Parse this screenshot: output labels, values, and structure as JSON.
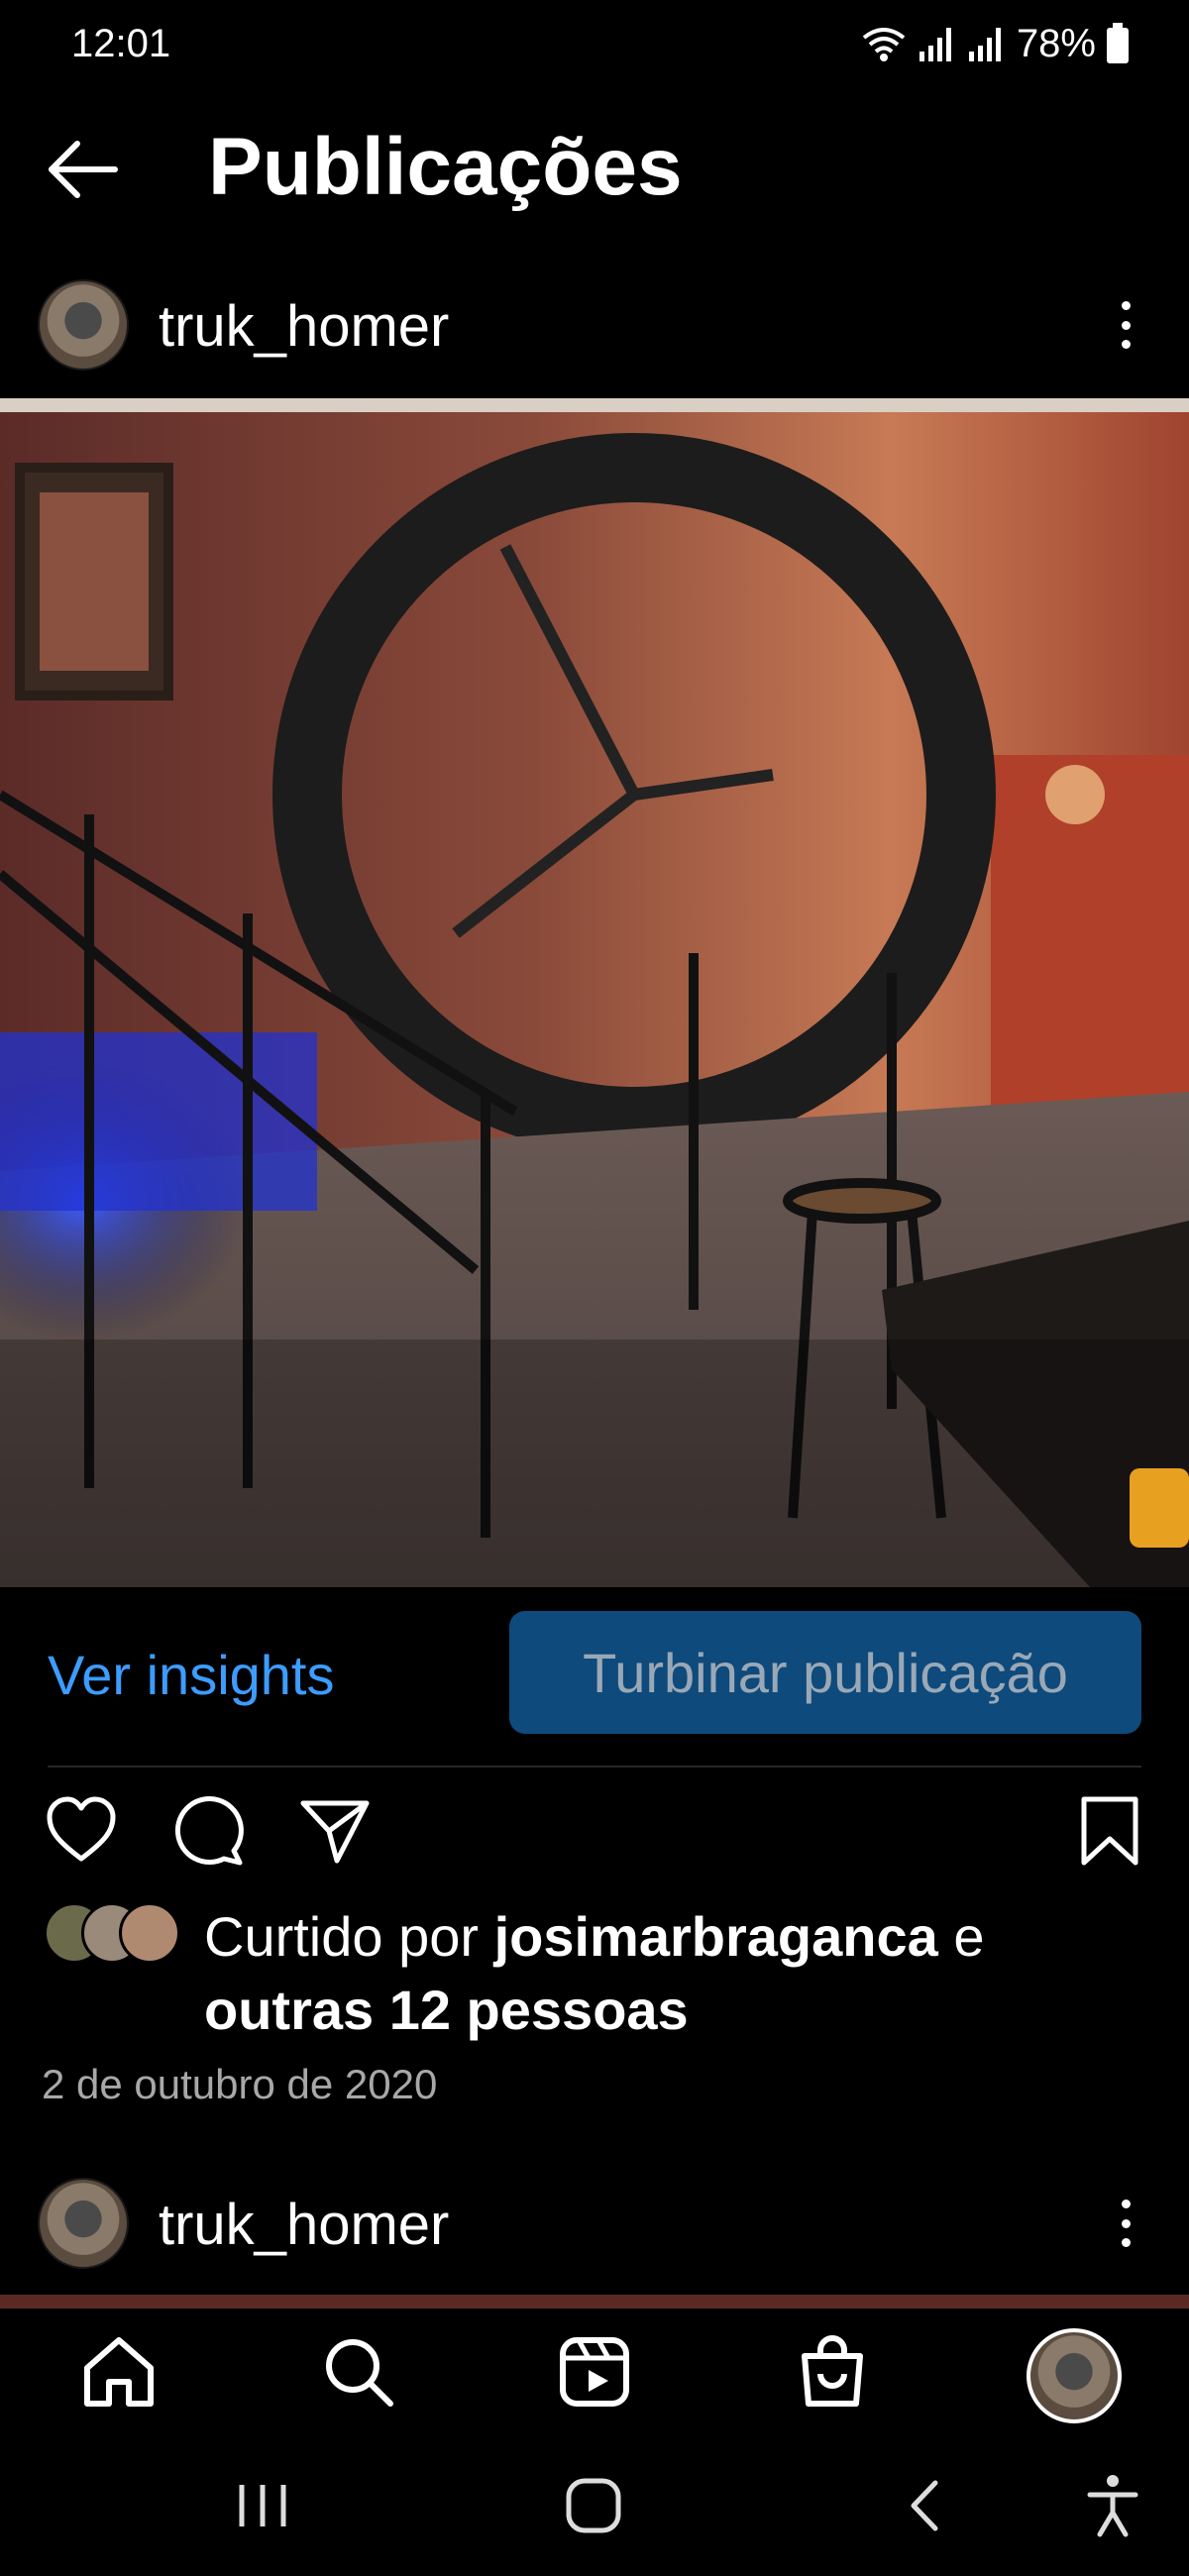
{
  "status_bar": {
    "time": "12:01",
    "battery": "78%",
    "icons": [
      "wifi-icon",
      "signal-icon",
      "signal-icon",
      "battery-icon"
    ]
  },
  "header": {
    "title": "Publicações",
    "back_icon": "arrow-left-icon"
  },
  "post": {
    "username": "truk_homer",
    "more_icon": "more-vertical-icon",
    "photo_alt": "photo"
  },
  "insights": {
    "view_label": "Ver insights",
    "boost_label": "Turbinar publicação"
  },
  "actions": {
    "icons": [
      "heart-icon",
      "comment-icon",
      "share-icon",
      "bookmark-icon"
    ]
  },
  "likes": {
    "prefix": "Curtido por ",
    "user": "josimarbraganca",
    "conjunction": " e",
    "others": "outras 12 pessoas"
  },
  "date": "2 de outubro de 2020",
  "next_post": {
    "username": "truk_homer"
  },
  "nav": {
    "icons": [
      "home-icon",
      "search-icon",
      "reels-icon",
      "shop-icon",
      "profile-avatar"
    ]
  },
  "colors": {
    "background": "#000000",
    "accent": "#3d9cff",
    "boost_bg": "#0e4a7c",
    "secondary_text": "#a8a8a8"
  }
}
